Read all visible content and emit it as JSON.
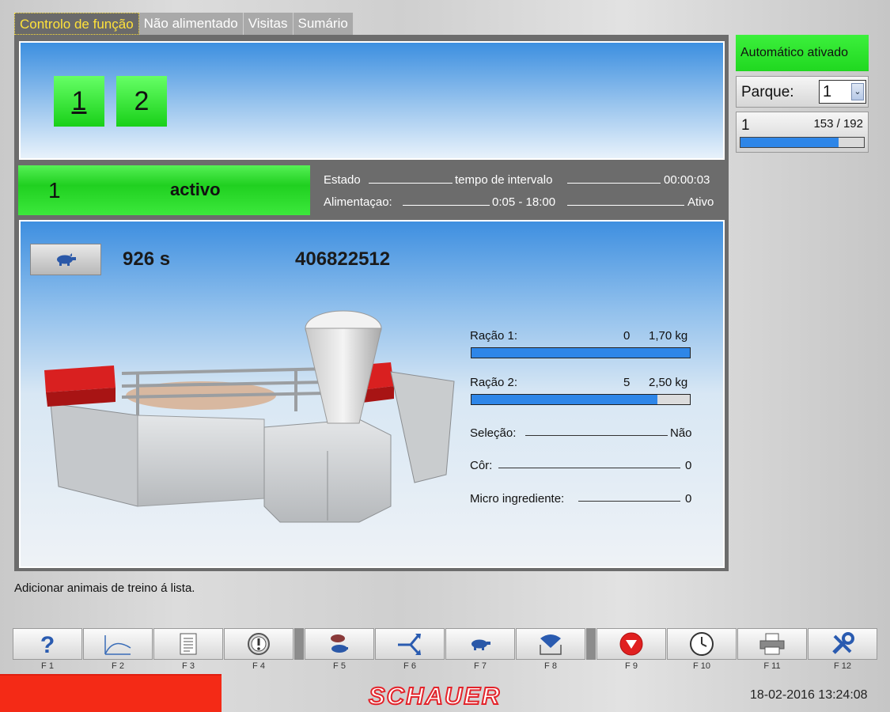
{
  "tabs": [
    "Controlo de função",
    "Não alimentado",
    "Visitas",
    "Sumário"
  ],
  "pen_buttons": [
    "1",
    "2"
  ],
  "status": {
    "number": "1",
    "text": "activo"
  },
  "info": {
    "row1_label": "Estado",
    "row1_mid": "tempo de intervalo",
    "row1_value": "00:00:03",
    "row2_label": "Alimentaçao:",
    "row2_mid": "0:05 - 18:00",
    "row2_value": "Ativo"
  },
  "animal": {
    "time": "926 s",
    "id": "406822512"
  },
  "rations": [
    {
      "label": "Ração 1:",
      "count": "0",
      "amount": "1,70 kg",
      "progress": 1.0
    },
    {
      "label": "Ração 2:",
      "count": "5",
      "amount": "2,50 kg",
      "progress": 0.85
    }
  ],
  "details": [
    {
      "label": "Seleção:",
      "value": "Não"
    },
    {
      "label": "Côr:",
      "value": "0"
    },
    {
      "label": "Micro ingrediente:",
      "value": "0"
    }
  ],
  "message": "Adicionar animais de treino á lista.",
  "right": {
    "auto": "Automático ativado",
    "parque_label": "Parque:",
    "parque_value": "1",
    "progress_left": "1",
    "progress_right": "153 / 192",
    "progress": 0.797
  },
  "fkeys": [
    "F 1",
    "F 2",
    "F 3",
    "F 4",
    "F 5",
    "F 6",
    "F 7",
    "F 8",
    "F 9",
    "F 10",
    "F 11",
    "F 12"
  ],
  "fkey_icons": [
    "help-icon",
    "curve-icon",
    "document-icon",
    "warning-icon",
    "pigs-icon",
    "branch-icon",
    "pig-icon",
    "feeder-icon",
    "stop-icon",
    "clock-icon",
    "printer-icon",
    "tools-icon"
  ],
  "brand": "SCHAUER",
  "datetime": "18-02-2016 13:24:08",
  "colors": {
    "active_tab": "#ffe23a",
    "green": "#20d020",
    "blue": "#2e86e8",
    "brand_red": "#e3242b"
  }
}
